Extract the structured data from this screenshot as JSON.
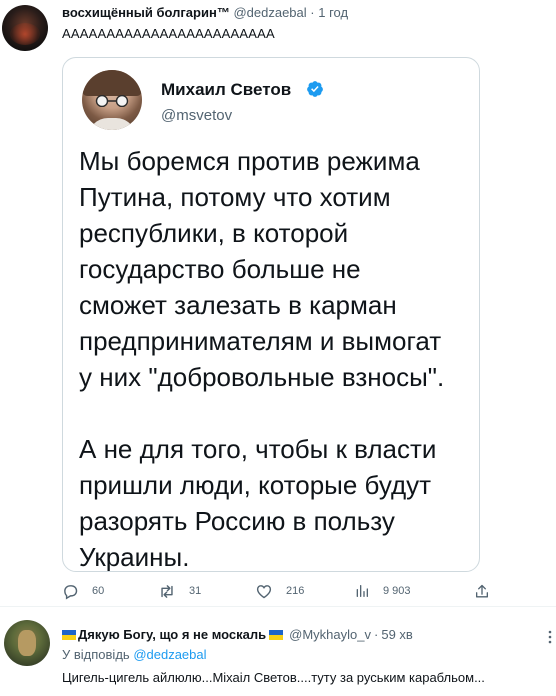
{
  "top_tweet": {
    "author_name": "восхищённый болгарин™",
    "author_handle": "@dedzaebal",
    "separator": "·",
    "time": "1 год",
    "text": "АААААААААААААААААААААААА",
    "embedded": {
      "author_name": "Михаил Светов",
      "author_handle": "@msvetov",
      "body": "Мы боремся против режима\nПутина, потому что хотим\nреспублики, в которой\nгосударство больше не\nсможет залезать в карман\nпредпринимателям и вымогат\nу них \"добровольные взносы\".\n\nА не для того, чтобы к власти\nпришли люди, которые будут\nразорять Россию в пользу\nУкраины."
    },
    "actions": {
      "replies": "60",
      "retweets": "31",
      "likes": "216",
      "views": "9 903"
    }
  },
  "reply_tweet": {
    "author_name": "Дякую Богу, що я не москаль",
    "author_handle": "@Mykhaylo_v",
    "separator": "·",
    "time": "59 хв",
    "reply_prefix": "У відповідь",
    "reply_mention": "@dedzaebal",
    "text": "Цигель-цигель айлюлю...Міхаіл Светов....туту за руським карабльом..."
  },
  "colors": {
    "primary_text": "#0f1419",
    "secondary_text": "#536471",
    "accent": "#1d9bf0",
    "border": "#cfd9de",
    "flag_blue": "#1d65c9",
    "flag_yellow": "#f7d117"
  },
  "icons": [
    "reply-icon",
    "retweet-icon",
    "like-icon",
    "views-icon",
    "share-icon",
    "verified-icon",
    "more-icon"
  ]
}
